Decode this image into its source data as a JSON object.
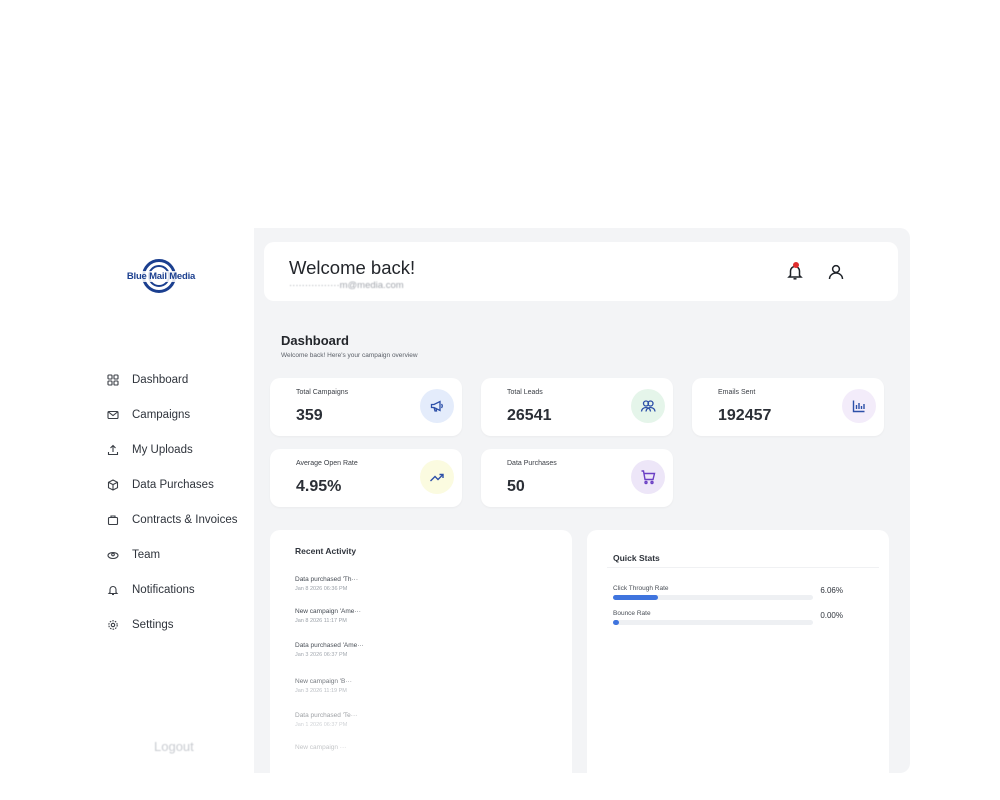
{
  "brand": {
    "logo_text": "Blue Mail Media"
  },
  "sidebar": {
    "items": [
      {
        "label": "Dashboard",
        "icon": "grid-icon"
      },
      {
        "label": "Campaigns",
        "icon": "mail-icon"
      },
      {
        "label": "My Uploads",
        "icon": "upload-icon"
      },
      {
        "label": "Data Purchases",
        "icon": "box-icon"
      },
      {
        "label": "Contracts & Invoices",
        "icon": "briefcase-icon"
      },
      {
        "label": "Team",
        "icon": "team-icon"
      },
      {
        "label": "Notifications",
        "icon": "bell-icon"
      },
      {
        "label": "Settings",
        "icon": "gear-icon"
      }
    ],
    "logout_label": "Logout"
  },
  "header": {
    "title": "Welcome back!",
    "email": "················m@media.com",
    "notification_dot_color": "#e02d2d"
  },
  "dashboard": {
    "title": "Dashboard",
    "subtitle": "Welcome back! Here's your campaign overview"
  },
  "stats": [
    {
      "label": "Total Campaigns",
      "value": "359",
      "icon": "megaphone-icon",
      "icon_bg": "#e4ecfb",
      "icon_color": "#2c4fa8"
    },
    {
      "label": "Total Leads",
      "value": "26541",
      "icon": "users-icon",
      "icon_bg": "#e5f5ea",
      "icon_color": "#2c4fa8"
    },
    {
      "label": "Emails Sent",
      "value": "192457",
      "icon": "bar-chart-icon",
      "icon_bg": "#f3ecfa",
      "icon_color": "#2c4fa8"
    },
    {
      "label": "Average Open Rate",
      "value": "4.95%",
      "icon": "trending-up-icon",
      "icon_bg": "#fbfbe0",
      "icon_color": "#2c4fa8"
    },
    {
      "label": "Data Purchases",
      "value": "50",
      "icon": "cart-icon",
      "icon_bg": "#ede6f8",
      "icon_color": "#6b3fc4"
    }
  ],
  "recent_activity": {
    "title": "Recent Activity",
    "items": [
      {
        "text": "Data purchased 'Th···",
        "time": "Jan 8 2026 06:36 PM"
      },
      {
        "text": "New campaign 'Ame···",
        "time": "Jan 8 2026 11:17 PM"
      },
      {
        "text": "Data purchased 'Ame···",
        "time": "Jan 3 2026 06:37 PM"
      },
      {
        "text": "New campaign 'B···",
        "time": "Jan 3 2026 11:19 PM"
      },
      {
        "text": "Data purchased 'Te···",
        "time": "Jan 1 2026 06:37 PM"
      },
      {
        "text": "New campaign ···",
        "time": ""
      }
    ]
  },
  "quick_stats": {
    "title": "Quick Stats",
    "rows": [
      {
        "label": "Click Through Rate",
        "value": "6.06%",
        "fill_fraction": 0.2272
      },
      {
        "label": "Bounce Rate",
        "value": "0.00%",
        "fill_fraction": 0.0
      }
    ],
    "bar_color": "#3f74de"
  }
}
